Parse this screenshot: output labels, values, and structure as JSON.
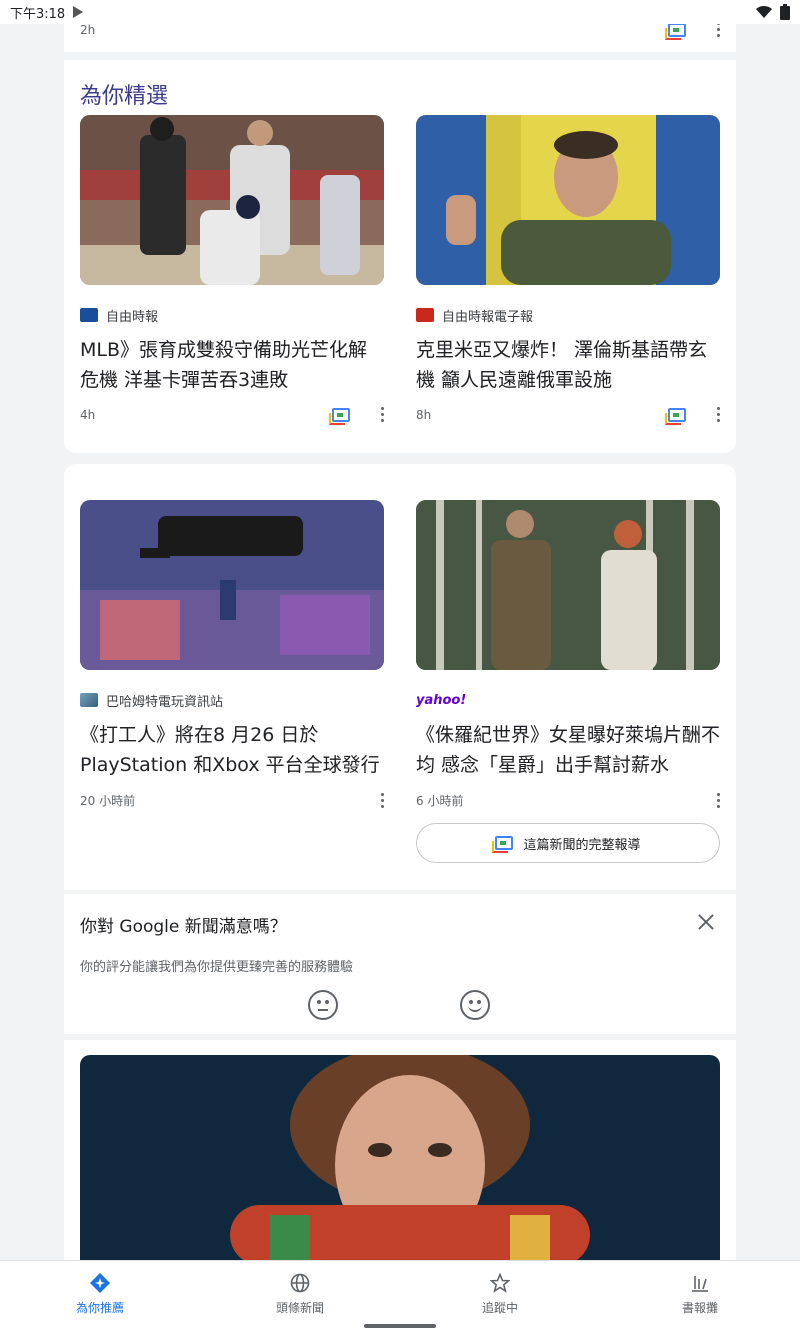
{
  "status_bar": {
    "time": "下午3:18"
  },
  "top_card": {
    "age": "2h"
  },
  "section": {
    "title": "為你精選"
  },
  "stories_row1": [
    {
      "source": "自由時報",
      "headline": "MLB》張育成雙殺守備助光芒化解危機 洋基卡彈苦吞3連敗",
      "age": "4h"
    },
    {
      "source": "自由時報電子報",
      "headline": "克里米亞又爆炸！ 澤倫斯基語帶玄機 籲人民遠離俄軍設施",
      "age": "8h"
    }
  ],
  "stories_row2": [
    {
      "source": "巴哈姆特電玩資訊站",
      "headline": "《打工人》將在8 月26 日於PlayStation 和Xbox 平台全球發行",
      "age": "20 小時前"
    },
    {
      "source": "yahoo!",
      "headline": "《侏羅紀世界》女星曝好萊塢片酬不均 感念「星爵」出手幫討薪水",
      "age": "6 小時前"
    }
  ],
  "full_coverage": {
    "label": "這篇新聞的完整報導"
  },
  "survey": {
    "title": "你對 Google 新聞滿意嗎？",
    "subtitle": "你的評分能讓我們為你提供更臻完善的服務體驗"
  },
  "bottom_nav": [
    {
      "label": "為你推薦",
      "icon": "for-you-icon",
      "active": true
    },
    {
      "label": "頭條新聞",
      "icon": "globe-icon",
      "active": false
    },
    {
      "label": "追蹤中",
      "icon": "star-icon",
      "active": false
    },
    {
      "label": "書報攤",
      "icon": "newsstand-icon",
      "active": false
    }
  ],
  "colors": {
    "accent": "#1a73e8",
    "section_title": "#3c3c8c"
  }
}
